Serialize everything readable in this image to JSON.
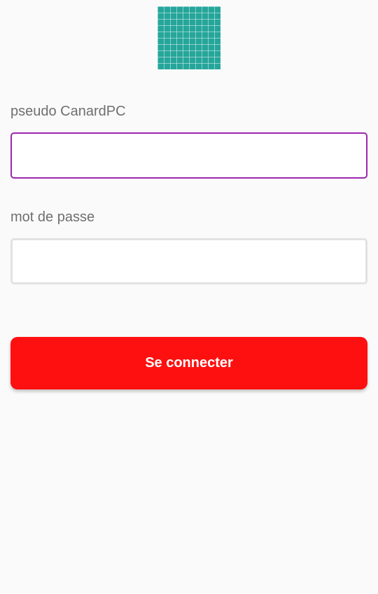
{
  "logo": {
    "icon": "grid-logo-icon",
    "color": "#26a69a"
  },
  "login_form": {
    "username": {
      "label": "pseudo CanardPC",
      "value": "",
      "placeholder": ""
    },
    "password": {
      "label": "mot de passe",
      "value": "",
      "placeholder": ""
    },
    "submit_label": "Se connecter"
  },
  "colors": {
    "accent_button": "#ff1010",
    "focused_field_border": "#9c27b0",
    "field_border": "#e2e2e2",
    "background": "#fafafa",
    "label_text": "#6f6f6f"
  }
}
